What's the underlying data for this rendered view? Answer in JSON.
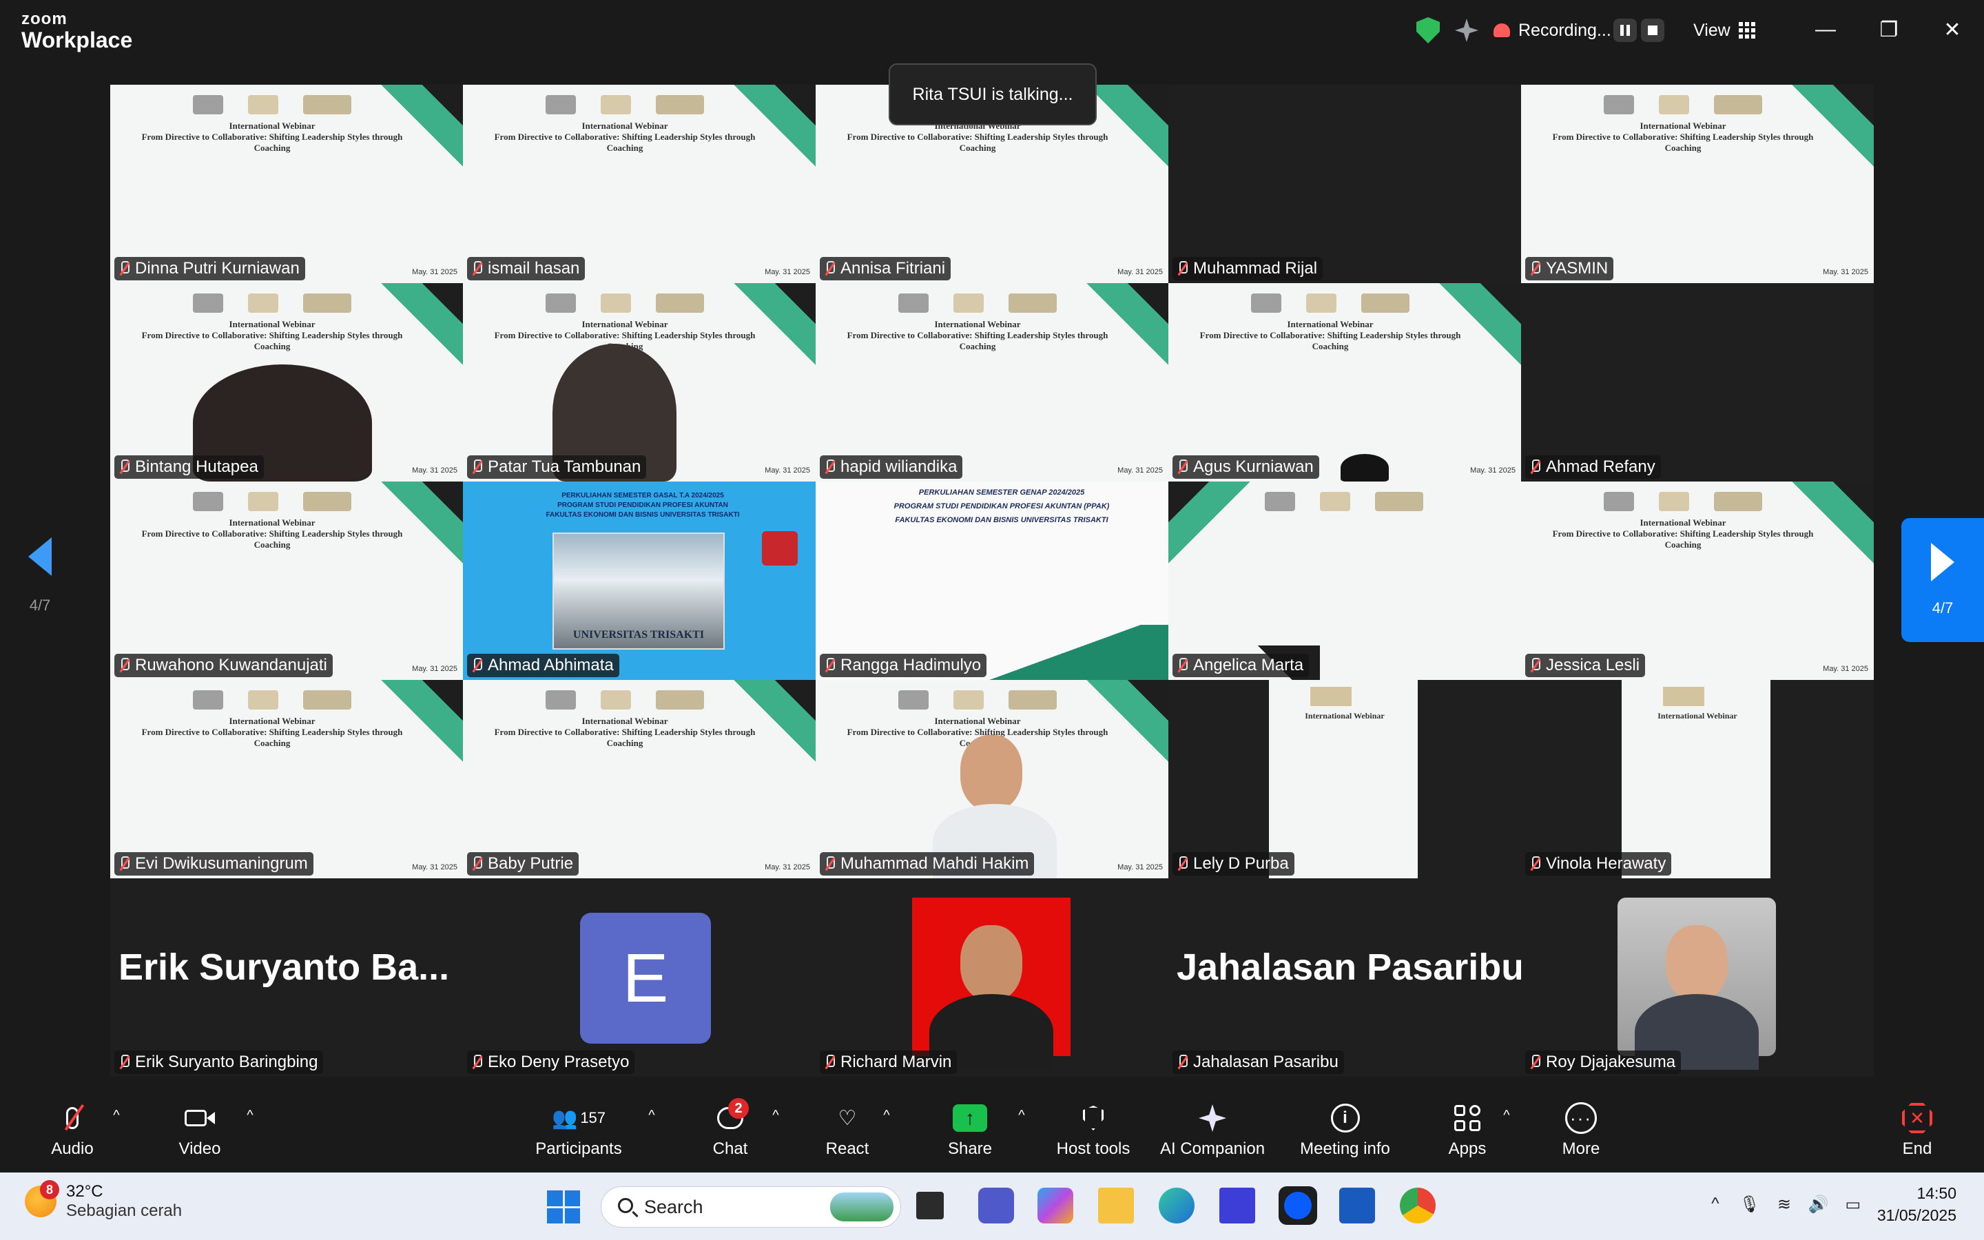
{
  "app": {
    "brand_top": "zoom",
    "brand_bottom": "Workplace",
    "recording_label": "Recording...",
    "view_label": "View",
    "talking_toast": "Rita TSUI is talking..."
  },
  "pager": {
    "prev_label": "4/7",
    "next_label": "4/7"
  },
  "slide": {
    "title_line1": "International Webinar",
    "title_line2": "From Directive to Collaborative: Shifting Leadership Styles through",
    "title_line3": "Coaching",
    "date": "May. 31 2025",
    "blue_line1": "PERKULIAHAN SEMESTER GASAL T.A 2024/2025",
    "blue_line2": "PROGRAM STUDI PENDIDIKAN PROFESI AKUNTAN",
    "blue_line3": "FAKULTAS EKONOMI DAN BISNIS UNIVERSITAS TRISAKTI",
    "blue_building": "UNIVERSITAS TRISAKTI",
    "white_line1": "PERKULIAHAN SEMESTER GENAP 2024/2025",
    "white_line2": "PROGRAM STUDI PENDIDIKAN PROFESI AKUNTAN (PPAK)",
    "white_line3": "FAKULTAS EKONOMI DAN BISNIS UNIVERSITAS TRISAKTI"
  },
  "participants": [
    {
      "name": "Dinna Putri Kurniawan"
    },
    {
      "name": "ismail hasan"
    },
    {
      "name": "Annisa Fitriani"
    },
    {
      "name": "Muhammad Rijal"
    },
    {
      "name": "YASMIN"
    },
    {
      "name": "Bintang Hutapea"
    },
    {
      "name": "Patar Tua Tambunan"
    },
    {
      "name": "hapid wiliandika"
    },
    {
      "name": "Agus Kurniawan"
    },
    {
      "name": "Ahmad Refany"
    },
    {
      "name": "Ruwahono Kuwandanujati"
    },
    {
      "name": "Ahmad Abhimata"
    },
    {
      "name": "Rangga Hadimulyo"
    },
    {
      "name": "Angelica Marta"
    },
    {
      "name": "Jessica Lesli"
    },
    {
      "name": "Evi Dwikusumaningrum"
    },
    {
      "name": "Baby Putrie"
    },
    {
      "name": "Muhammad Mahdi Hakim"
    },
    {
      "name": "Lely D Purba"
    },
    {
      "name": "Vinola Herawaty"
    },
    {
      "name": "Erik Suryanto Baringbing",
      "display": "Erik Suryanto Ba..."
    },
    {
      "name": "Eko Deny Prasetyo",
      "avatar_letter": "E"
    },
    {
      "name": "Richard Marvin"
    },
    {
      "name": "Jahalasan Pasaribu",
      "display": "Jahalasan Pasaribu"
    },
    {
      "name": "Roy Djajakesuma"
    }
  ],
  "toolbar": {
    "audio": "Audio",
    "video": "Video",
    "participants": "Participants",
    "participants_count": "157",
    "chat": "Chat",
    "chat_badge": "2",
    "react": "React",
    "share": "Share",
    "host_tools": "Host tools",
    "ai_companion": "AI Companion",
    "meeting_info": "Meeting info",
    "apps": "Apps",
    "more": "More",
    "end": "End"
  },
  "taskbar": {
    "weather_temp": "32°C",
    "weather_desc": "Sebagian cerah",
    "weather_badge": "8",
    "search_placeholder": "Search",
    "time": "14:50",
    "date": "31/05/2025"
  },
  "colors": {
    "accent_blue": "#0b7cf5",
    "share_green": "#19c04e",
    "end_red": "#ff3b3b",
    "slide_teal": "#3db08a",
    "avatar_purple": "#5b6ac9"
  }
}
